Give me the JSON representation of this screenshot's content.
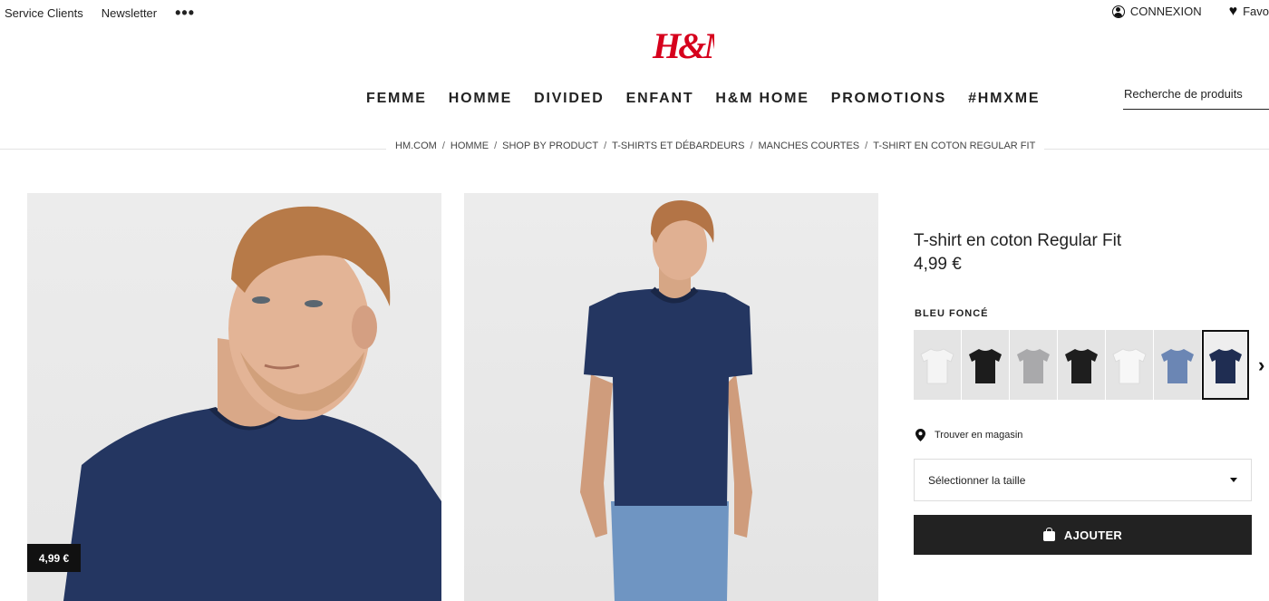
{
  "topbar": {
    "service_clients": "Service Clients",
    "newsletter": "Newsletter",
    "more": "•••",
    "connexion": "CONNEXION",
    "favoris": "Favo"
  },
  "brand": {
    "logo_text": "H&M",
    "color": "#d6001c"
  },
  "nav": [
    "FEMME",
    "HOMME",
    "DIVIDED",
    "ENFANT",
    "H&M HOME",
    "PROMOTIONS",
    "#HMXME"
  ],
  "search": {
    "placeholder": "Recherche de produits"
  },
  "breadcrumb": [
    "HM.COM",
    "HOMME",
    "SHOP BY PRODUCT",
    "T-SHIRTS ET DÉBARDEURS",
    "MANCHES COURTES",
    "T-SHIRT EN COTON REGULAR FIT"
  ],
  "breadcrumb_separator": "/",
  "product": {
    "title": "T-shirt en coton Regular Fit",
    "price": "4,99 €",
    "badge_price": "4,99 €",
    "color_label": "BLEU FONCÉ",
    "swatches": [
      {
        "color": "#f4f4f4",
        "name": "white"
      },
      {
        "color": "#1c1c1c",
        "name": "black"
      },
      {
        "color": "#a9a9ab",
        "name": "grey"
      },
      {
        "color": "#1e1e1e",
        "name": "black"
      },
      {
        "color": "#f7f7f7",
        "name": "white"
      },
      {
        "color": "#6b86b4",
        "name": "light-blue"
      },
      {
        "color": "#1f2d52",
        "name": "navy"
      }
    ],
    "selected_swatch": 6,
    "shirt_color": "#243661",
    "store_link": "Trouver en magasin",
    "size_select": "Sélectionner la taille",
    "add_button": "AJOUTER"
  }
}
